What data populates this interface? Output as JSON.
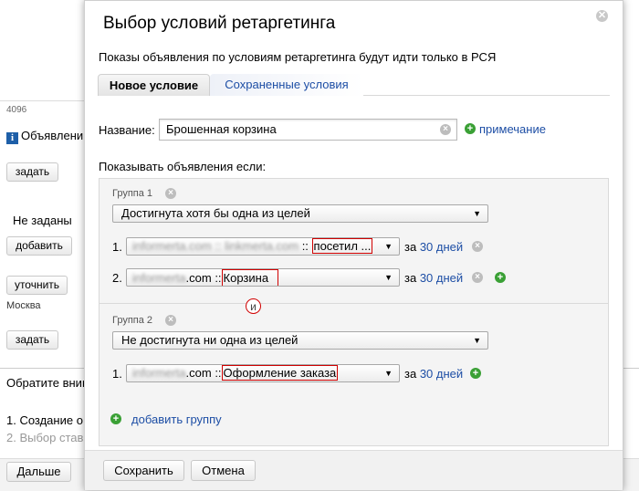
{
  "background": {
    "char_count": "4096",
    "info_text": "Объявлени",
    "btn_set1": "задать",
    "not_set": "Не заданы",
    "btn_add": "добавить",
    "btn_refine": "уточнить",
    "region": "Москва",
    "btn_set2": "задать",
    "notice": "Обратите вним",
    "step1": "1. Создание о",
    "step2": "2. Выбор став",
    "btn_next": "Дальше"
  },
  "dialog": {
    "title": "Выбор условий ретаргетинга",
    "subtitle": "Показы объявления по условиям ретаргетинга будут идти только в РСЯ",
    "tabs": [
      {
        "label": "Новое условие",
        "active": true
      },
      {
        "label": "Сохраненные условия",
        "active": false
      }
    ],
    "name_label": "Название:",
    "name_value": "Брошенная корзина",
    "note_link": "примечание",
    "show_if": "Показывать объявления если:",
    "connector": "и",
    "add_group": "добавить группу",
    "groups": [
      {
        "label": "Группа 1",
        "mode": "Достигнута хотя бы одна из целей",
        "goals": [
          {
            "num": "1.",
            "site_a": "informerta.com",
            "site_b": "linkmerta.com",
            "goal": "посетил ...",
            "for_label": "за",
            "days": "30 дней"
          },
          {
            "num": "2.",
            "site_a": "informerta",
            "site_b": ".com ::",
            "goal": "Корзина",
            "for_label": "за",
            "days": "30 дней"
          }
        ]
      },
      {
        "label": "Группа 2",
        "mode": "Не достигнута ни одна из целей",
        "goals": [
          {
            "num": "1.",
            "site_a": "informerta",
            "site_b": ".com ::",
            "goal": "Оформление заказа",
            "for_label": "за",
            "days": "30 дней"
          }
        ]
      }
    ],
    "save_btn": "Сохранить",
    "cancel_btn": "Отмена"
  },
  "colors": {
    "link": "#1d4ea5",
    "highlight": "#d00000",
    "plus": "#3aa035"
  }
}
